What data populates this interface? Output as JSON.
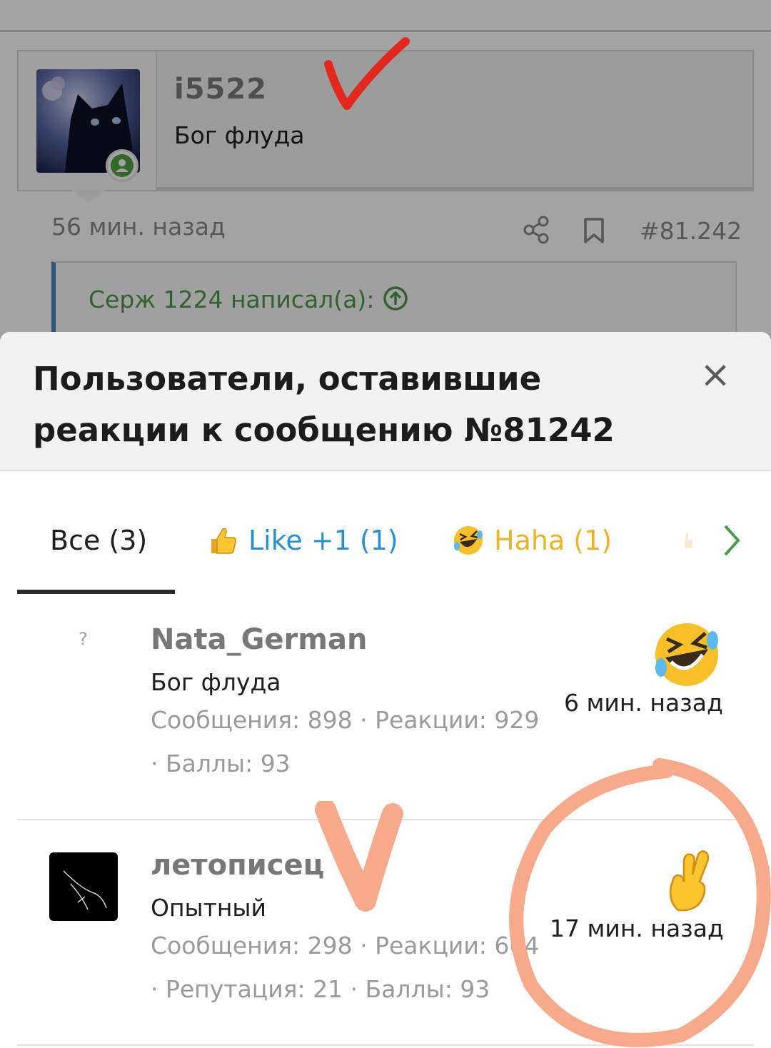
{
  "post": {
    "username": "i5522",
    "user_title": "Бог флуда",
    "time": "56 мин. назад",
    "post_number": "#81.242",
    "quote_author": "Серж 1224 написал(а):"
  },
  "modal": {
    "title": "Пользователи, оставившие реакции к сообщению №81242",
    "close_symbol": "×"
  },
  "tabs": [
    {
      "label": "Все (3)"
    },
    {
      "label": "Like +1 (1)",
      "icon": "thumbs-up-icon"
    },
    {
      "label": "Haha (1)",
      "icon": "laughing-face-icon"
    }
  ],
  "reactions": [
    {
      "name": "Nata_German",
      "title": "Бог флуда",
      "stats": "Сообщения: 898 · Реакции: 929 · Баллы: 93",
      "avatar_placeholder": "?",
      "reaction_icon": "laughing-face-icon",
      "time": "6 мин. назад"
    },
    {
      "name": "летописец",
      "title": "Опытный",
      "stats": "Сообщения: 298 · Реакции: 664 · Репутация: 21 · Баллы: 93",
      "reaction_icon": "crossed-fingers-icon",
      "time": "17 мин. назад"
    }
  ],
  "colors": {
    "like": "#2c8fd0",
    "haha": "#e8b52c",
    "quote_author": "#4e9a4a",
    "annotation_red": "#e5281f",
    "annotation_orange": "#f7a98c"
  }
}
